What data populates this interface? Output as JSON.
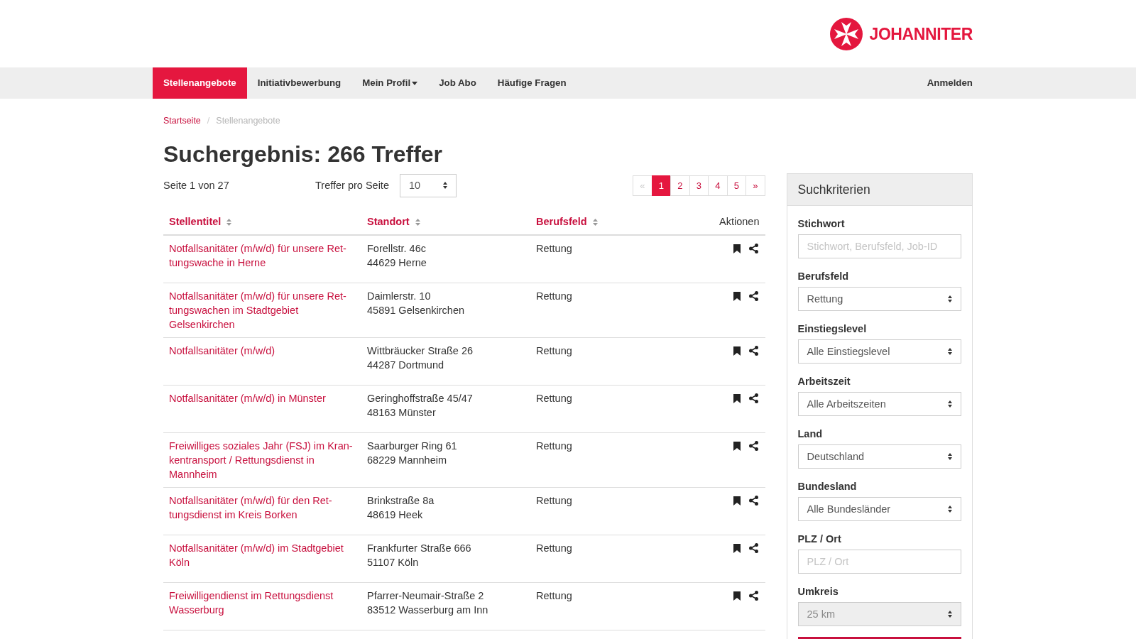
{
  "header": {
    "brand": "JOHANNITER"
  },
  "nav": {
    "items": [
      {
        "label": "Stellenangebote",
        "kind": "link",
        "selected": true
      },
      {
        "label": "Initiativbewerbung",
        "kind": "link",
        "selected": false
      },
      {
        "label": "Mein Profil",
        "kind": "dropdown",
        "selected": false
      },
      {
        "label": "Job Abo",
        "kind": "link",
        "selected": false
      },
      {
        "label": "Häufige Fragen",
        "kind": "link",
        "selected": false
      }
    ],
    "login": "Anmelden"
  },
  "breadcrumb": {
    "separator": "/",
    "items": [
      {
        "label": "Startseite",
        "active": false
      },
      {
        "label": "Stellenangebote",
        "active": true
      }
    ]
  },
  "title": "Suchergebnis: 266 Treffer",
  "results_toolbar": {
    "page_info": "Seite 1 von 27",
    "per_page_label": "Treffer pro Seite",
    "per_page_value": "10",
    "pagination": [
      {
        "label": "«",
        "selected": false,
        "disabled": true
      },
      {
        "label": "1",
        "selected": true,
        "disabled": false
      },
      {
        "label": "2",
        "selected": false,
        "disabled": false
      },
      {
        "label": "3",
        "selected": false,
        "disabled": false
      },
      {
        "label": "4",
        "selected": false,
        "disabled": false
      },
      {
        "label": "5",
        "selected": false,
        "disabled": false
      },
      {
        "label": "»",
        "selected": false,
        "disabled": false
      }
    ]
  },
  "table": {
    "columns": [
      {
        "label": "Stellentitel",
        "kind": "sortable"
      },
      {
        "label": "Standort",
        "kind": "sortable"
      },
      {
        "label": "Berufsfeld",
        "kind": "sortable"
      },
      {
        "label": "Aktionen",
        "kind": "plain"
      }
    ],
    "rows": [
      {
        "title": "Notfallsanitäter (m/w/d) für unsere Ret-tungswache in Herne",
        "street": "Forellstr. 46c",
        "city": "44629 Herne",
        "field": "Rettung"
      },
      {
        "title": "Notfallsanitäter (m/w/d) für unsere Ret-tungswachen im Stadtgebiet Gelsenkirchen",
        "street": "Daimlerstr. 10",
        "city": "45891 Gelsenkirchen",
        "field": "Rettung"
      },
      {
        "title": "Notfallsanitäter (m/w/d)",
        "street": "Wittbräucker Straße 26",
        "city": "44287 Dortmund",
        "field": "Rettung"
      },
      {
        "title": "Notfallsanitäter (m/w/d) in Münster",
        "street": "Geringhoffstraße 45/47",
        "city": "48163 Münster",
        "field": "Rettung"
      },
      {
        "title": "Freiwilliges soziales Jahr (FSJ) im Kran-kentransport / Rettungsdienst in Mannheim",
        "street": "Saarburger Ring 61",
        "city": "68229 Mannheim",
        "field": "Rettung"
      },
      {
        "title": "Notfallsanitäter (m/w/d) für den Ret-tungsdienst im Kreis Borken",
        "street": "Brinkstraße 8a",
        "city": "48619 Heek",
        "field": "Rettung"
      },
      {
        "title": "Notfallsanitäter (m/w/d) im Stadtgebiet Köln",
        "street": "Frankfurter Straße 666",
        "city": "51107 Köln",
        "field": "Rettung"
      },
      {
        "title": "Freiwilligendienst im Rettungsdienst Wasserburg",
        "street": "Pfarrer-Neumair-Straße 2",
        "city": "83512 Wasserburg am Inn",
        "field": "Rettung"
      }
    ]
  },
  "sidebar": {
    "title": "Suchkriterien",
    "filters": [
      {
        "label": "Stichwort",
        "kind": "input",
        "placeholder": "Stichwort, Berufsfeld, Job-ID",
        "disabled": false
      },
      {
        "label": "Berufsfeld",
        "kind": "select",
        "value": "Rettung",
        "disabled": false
      },
      {
        "label": "Einstiegslevel",
        "kind": "select",
        "value": "Alle Einstiegslevel",
        "disabled": false
      },
      {
        "label": "Arbeitszeit",
        "kind": "select",
        "value": "Alle Arbeitszeiten",
        "disabled": false
      },
      {
        "label": "Land",
        "kind": "select",
        "value": "Deutschland",
        "disabled": false
      },
      {
        "label": "Bundesland",
        "kind": "select",
        "value": "Alle Bundesländer",
        "disabled": false
      },
      {
        "label": "PLZ / Ort",
        "kind": "input",
        "placeholder": "PLZ / Ort",
        "disabled": false
      },
      {
        "label": "Umkreis",
        "kind": "select",
        "value": "25 km",
        "disabled": true
      }
    ]
  }
}
